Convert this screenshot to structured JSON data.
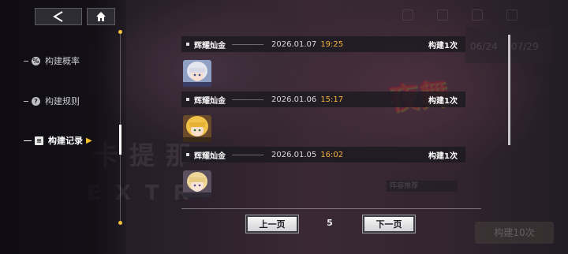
{
  "nav": {
    "items": [
      {
        "label": "构建概率",
        "icon": "percent-icon"
      },
      {
        "label": "构建规则",
        "icon": "question-icon"
      },
      {
        "label": "构建记录",
        "icon": "record-icon",
        "active": true
      }
    ]
  },
  "records": [
    {
      "pool": "辉耀灿金",
      "date": "2026.01.07",
      "time": "19:25",
      "count": "构建1次",
      "avatar": "silver-hair-character-avatar"
    },
    {
      "pool": "辉耀灿金",
      "date": "2026.01.06",
      "time": "15:17",
      "count": "构建1次",
      "avatar": "blonde-character-avatar"
    },
    {
      "pool": "辉耀灿金",
      "date": "2026.01.05",
      "time": "16:02",
      "count": "构建1次",
      "avatar": "light-hair-character-avatar"
    }
  ],
  "pagination": {
    "prev_label": "上一页",
    "next_label": "下一页",
    "current_page": "5"
  },
  "background": {
    "watermark_1": "卡提那",
    "watermark_2": "EXTR",
    "logo": "夜舞",
    "dates": [
      "06/24",
      "07/29"
    ],
    "bottom_button": "构建10次",
    "tag": "阵容推荐"
  },
  "colors": {
    "accent": "#f4b33a",
    "nav_arrow": "#f5c02a",
    "row_bg": "#1c1a20"
  }
}
